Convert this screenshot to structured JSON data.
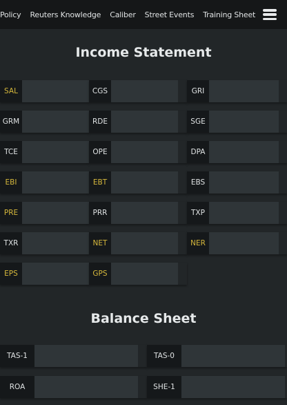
{
  "nav": {
    "items": [
      "Policy",
      "Reuters Knowledge",
      "Caliber",
      "Street Events",
      "Training Sheet"
    ],
    "menu_icon": "hamburger-menu-icon"
  },
  "colors": {
    "highlight": "#d6b83c",
    "background": "#222628",
    "navbar": "#151718",
    "input": "#2f3538"
  },
  "income_statement": {
    "title": "Income Statement",
    "fields": [
      {
        "label": "SAL",
        "highlight": true,
        "value": ""
      },
      {
        "label": "CGS",
        "highlight": false,
        "value": ""
      },
      {
        "label": "GRI",
        "highlight": false,
        "value": ""
      },
      {
        "label": "GRM",
        "highlight": false,
        "value": ""
      },
      {
        "label": "RDE",
        "highlight": false,
        "value": ""
      },
      {
        "label": "SGE",
        "highlight": false,
        "value": ""
      },
      {
        "label": "TCE",
        "highlight": false,
        "value": ""
      },
      {
        "label": "OPE",
        "highlight": false,
        "value": ""
      },
      {
        "label": "DPA",
        "highlight": false,
        "value": ""
      },
      {
        "label": "EBI",
        "highlight": true,
        "value": ""
      },
      {
        "label": "EBT",
        "highlight": true,
        "value": ""
      },
      {
        "label": "EBS",
        "highlight": false,
        "value": ""
      },
      {
        "label": "PRE",
        "highlight": true,
        "value": ""
      },
      {
        "label": "PRR",
        "highlight": false,
        "value": ""
      },
      {
        "label": "TXP",
        "highlight": false,
        "value": ""
      },
      {
        "label": "TXR",
        "highlight": false,
        "value": ""
      },
      {
        "label": "NET",
        "highlight": true,
        "value": ""
      },
      {
        "label": "NER",
        "highlight": true,
        "value": ""
      },
      {
        "label": "EPS",
        "highlight": true,
        "value": ""
      },
      {
        "label": "GPS",
        "highlight": true,
        "value": ""
      }
    ]
  },
  "balance_sheet": {
    "title": "Balance Sheet",
    "fields": [
      {
        "label": "TAS-1",
        "highlight": false,
        "value": ""
      },
      {
        "label": "TAS-0",
        "highlight": false,
        "value": ""
      },
      {
        "label": "ROA",
        "highlight": false,
        "value": ""
      },
      {
        "label": "SHE-1",
        "highlight": false,
        "value": ""
      }
    ]
  }
}
